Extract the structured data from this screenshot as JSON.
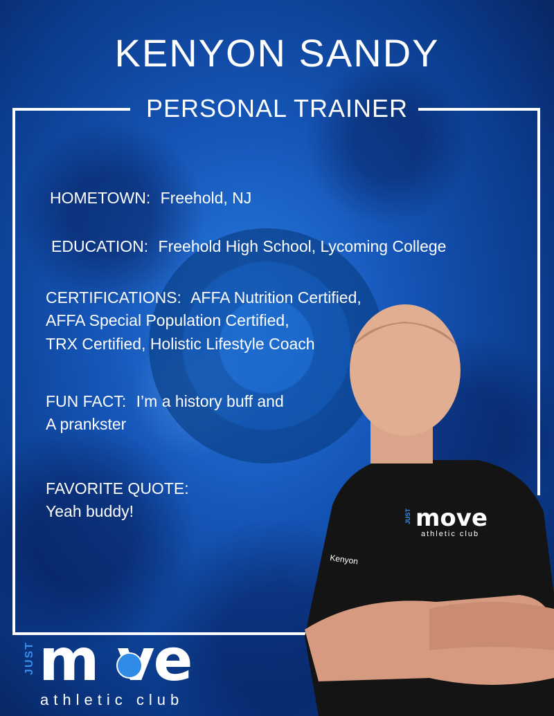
{
  "header": {
    "name": "KENYON SANDY",
    "role": "PERSONAL TRAINER"
  },
  "profile": {
    "hometown": {
      "label": "HOMETOWN:",
      "value": "Freehold, NJ"
    },
    "education": {
      "label": "EDUCATION:",
      "value": "Freehold High School, Lycoming College"
    },
    "certifications": {
      "label": "CERTIFICATIONS:",
      "line1": "AFFA Nutrition Certified,",
      "line2": "AFFA Special Population Certified,",
      "line3": "TRX Certified, Holistic Lifestyle Coach"
    },
    "fun_fact": {
      "label": "FUN FACT:",
      "line1": "I’m a history buff and",
      "line2": "A prankster"
    },
    "favorite_quote": {
      "label": "FAVORITE QUOTE:",
      "value": "Yeah buddy!"
    }
  },
  "photo": {
    "shirt_text": "Kenyon",
    "shirt_logo": "move",
    "shirt_logo_sub": "athletic club",
    "shirt_logo_just": "JUST"
  },
  "brand": {
    "just": "JUST",
    "move": "m  ve",
    "tagline": "athletic club",
    "accent": "#2f8be6",
    "background": "#1556b8"
  }
}
